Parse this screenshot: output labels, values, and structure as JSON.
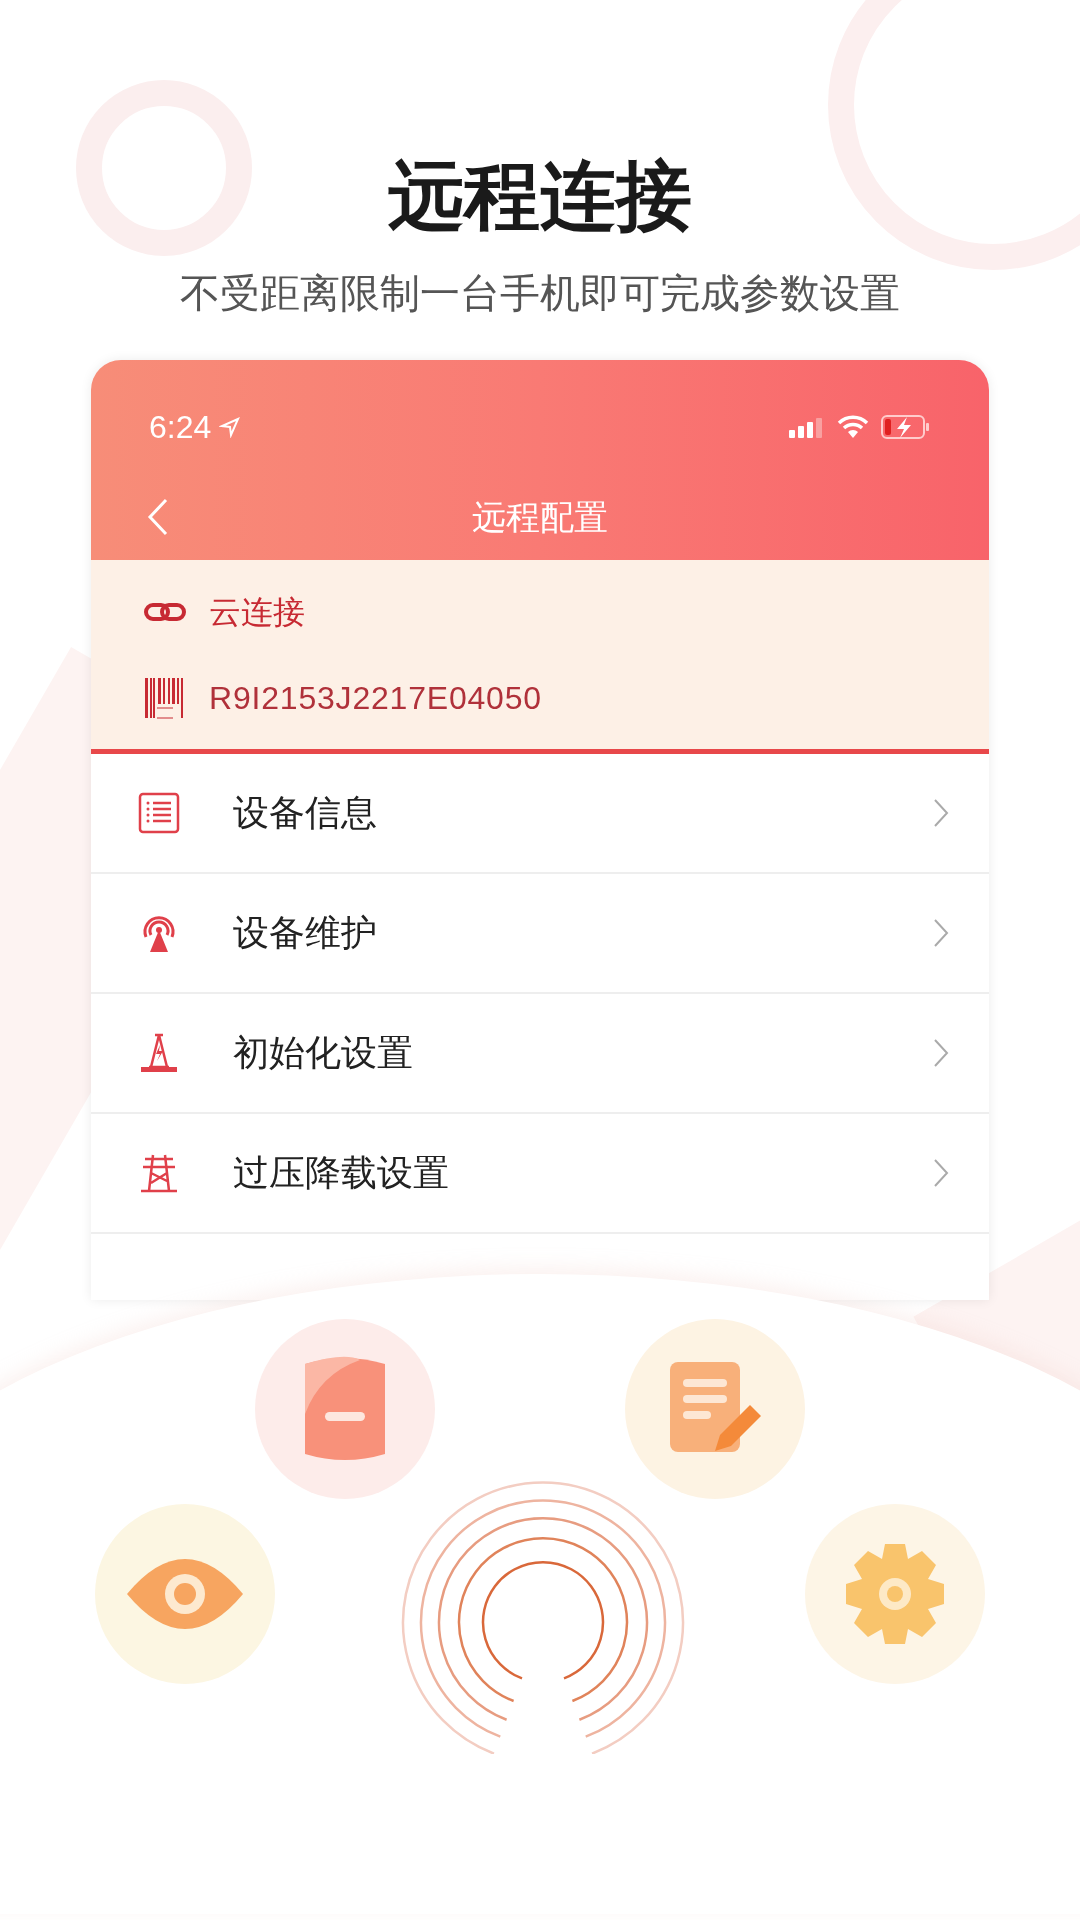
{
  "headline": "远程连接",
  "subtitle": "不受距离限制一台手机即可完成参数设置",
  "phone": {
    "status_bar": {
      "time": "6:24"
    },
    "nav": {
      "title": "远程配置"
    },
    "info": {
      "connection": "云连接",
      "serial": "R9I2153J2217E04050"
    },
    "menu": [
      {
        "label": "设备信息"
      },
      {
        "label": "设备维护"
      },
      {
        "label": "初始化设置"
      },
      {
        "label": "过压降载设置"
      }
    ]
  }
}
